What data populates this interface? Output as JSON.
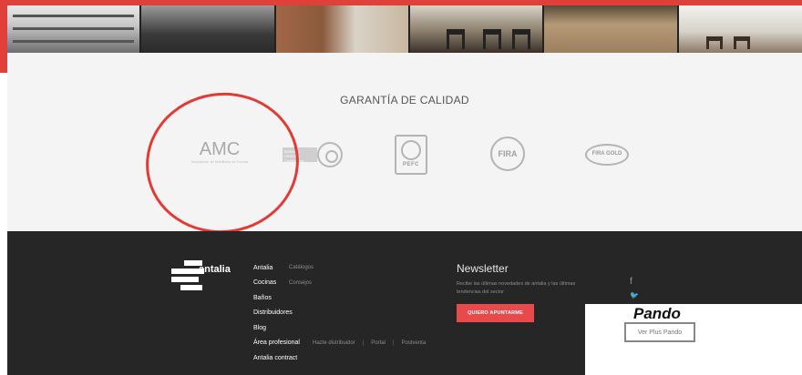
{
  "quality": {
    "title": "GARANTÍA DE CALIDAD",
    "logos": {
      "amc_mark": "AMC",
      "amc_sub": "Asociación de Mobiliario de Cocina",
      "bv_text": "BUREAU VERITAS Certification",
      "pefc": "PEFC",
      "fira": "FIRA",
      "firagold": "FIRA GOLD"
    }
  },
  "footer": {
    "brand": "antalia",
    "nav": [
      {
        "main": "Antalia",
        "subs": [
          "Catálogos"
        ]
      },
      {
        "main": "Cocinas",
        "subs": [
          "Consejos"
        ]
      },
      {
        "main": "Baños",
        "subs": []
      },
      {
        "main": "Distribuidores",
        "subs": []
      },
      {
        "main": "Blog",
        "subs": []
      },
      {
        "main": "Área profesional",
        "subs": [
          "Hazte distribuidor",
          "Portal",
          "Postventa"
        ]
      },
      {
        "main": "Antalia contract",
        "subs": []
      }
    ],
    "newsletter": {
      "title": "Newsletter",
      "desc": "Recibe las últimas novedades de antalia y las últimas tendencias del sector",
      "button": "QUIERO APUNTARME"
    },
    "social": {
      "facebook": "f",
      "twitter": "🐦"
    },
    "separator": "|"
  },
  "pando": {
    "logo": "Pando",
    "button": "Ver Plus Pando"
  },
  "colors": {
    "accent_red": "#e84a4c",
    "annotation_red": "#e43a36",
    "footer_bg": "#262626"
  }
}
